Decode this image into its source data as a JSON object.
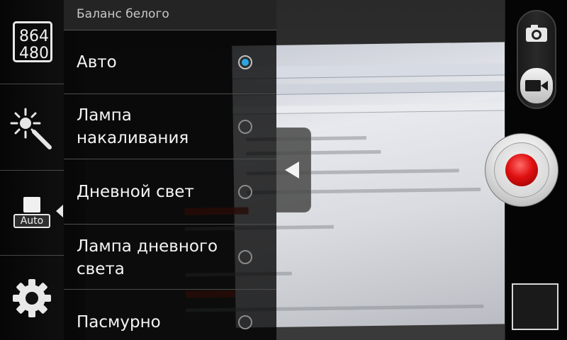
{
  "viewfinder": {
    "resolution_width": "864",
    "resolution_height": "480",
    "white_balance_indicator": "Auto"
  },
  "white_balance_menu": {
    "title": "Баланс белого",
    "options": [
      {
        "label": "Авто",
        "selected": true
      },
      {
        "label": "Лампа\nнакаливания",
        "selected": false
      },
      {
        "label": "Дневной свет",
        "selected": false
      },
      {
        "label": "Лампа дневного\nсвета",
        "selected": false
      },
      {
        "label": "Пасмурно",
        "selected": false
      }
    ]
  },
  "icons": {
    "resolution": "resolution-icon",
    "effects": "brightness-wand-icon",
    "white_balance": "white-balance-auto-icon",
    "settings": "gear-icon",
    "collapse": "chevron-left-icon",
    "photo_mode": "camera-icon",
    "video_mode": "video-camera-icon",
    "record": "record-button",
    "thumbnail": "gallery-thumbnail"
  },
  "colors": {
    "accent": "#2aa6e0",
    "record": "#e01010"
  }
}
